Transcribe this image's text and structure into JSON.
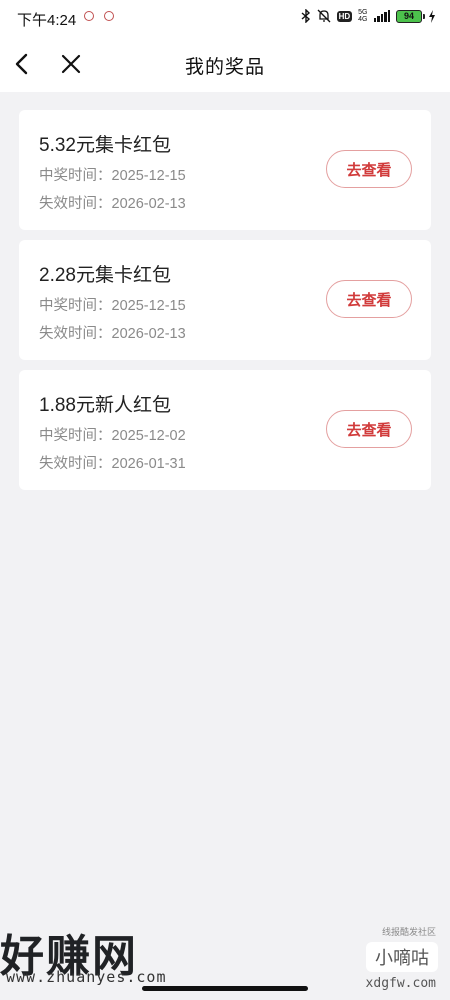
{
  "status_bar": {
    "time": "下午4:24",
    "network": "5G",
    "network_sub": "4G",
    "hd": "HD",
    "battery": "94"
  },
  "header": {
    "title": "我的奖品"
  },
  "prizes": [
    {
      "name": "5.32元集卡红包",
      "win_time": "中奖时间：2025-12-15",
      "expire_time": "失效时间：2026-02-13",
      "button": "去查看"
    },
    {
      "name": "2.28元集卡红包",
      "win_time": "中奖时间：2025-12-15",
      "expire_time": "失效时间：2026-02-13",
      "button": "去查看"
    },
    {
      "name": "1.88元新人红包",
      "win_time": "中奖时间：2025-12-02",
      "expire_time": "失效时间：2026-01-31",
      "button": "去查看"
    }
  ],
  "watermarks": {
    "left_logo": "好赚网",
    "left_url": "www.zhuanyes.com",
    "right_top": "线报酷发社区",
    "right_logo": "小嘀咕",
    "right_url": "xdgfw.com"
  },
  "colors": {
    "accent": "#d13b3b",
    "background": "#f2f2f4"
  }
}
